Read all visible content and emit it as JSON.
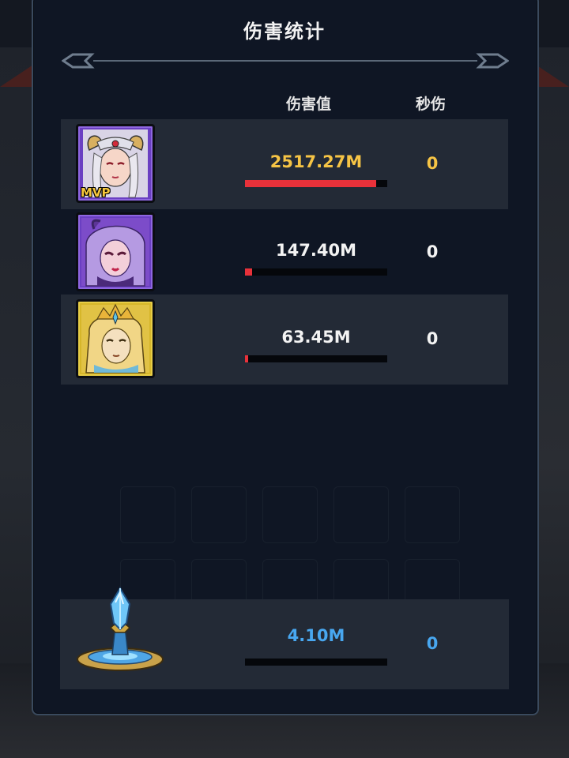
{
  "title": "伤害统计",
  "columns": {
    "damage": "伤害值",
    "dps": "秒伤"
  },
  "rows": [
    {
      "hero": "white-haired-horned-heroine",
      "frame": "purple",
      "badge": "MVP",
      "damage": "2517.27M",
      "damage_fraction": 0.92,
      "dps": "0"
    },
    {
      "hero": "purple-haired-demon-heroine",
      "frame": "purple",
      "badge": "",
      "damage": "147.40M",
      "damage_fraction": 0.05,
      "dps": "0"
    },
    {
      "hero": "golden-crowned-hero",
      "frame": "gold",
      "badge": "",
      "damage": "63.45M",
      "damage_fraction": 0.02,
      "dps": "0"
    }
  ],
  "summon": {
    "icon": "crystal-altar-icon",
    "damage": "4.10M",
    "damage_fraction": 0.0,
    "dps": "0"
  },
  "colors": {
    "accent_gold": "#f6c445",
    "accent_blue": "#48a7f0",
    "bar_red": "#e8313a"
  }
}
